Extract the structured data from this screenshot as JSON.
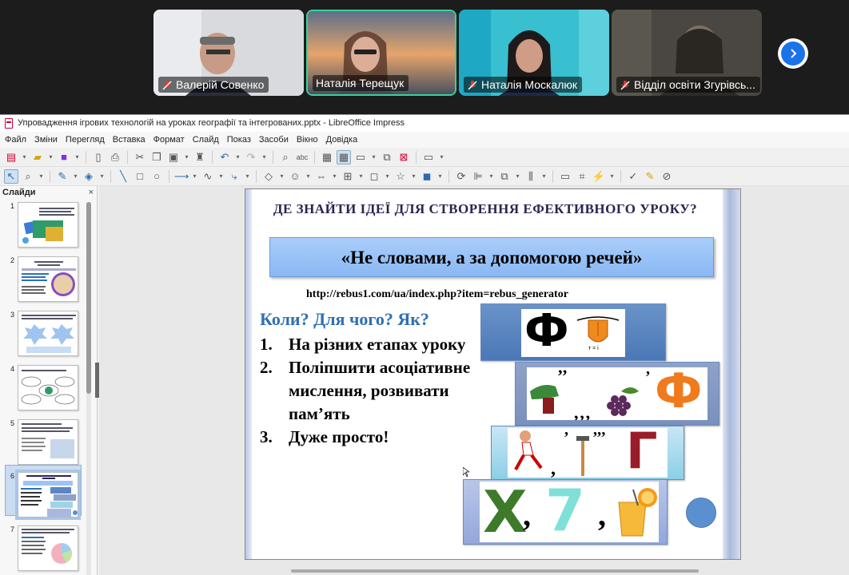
{
  "participants": [
    {
      "name": "Валерій Совенко",
      "muted": true
    },
    {
      "name": "Наталія Терещук",
      "muted": false,
      "active_speaker": true
    },
    {
      "name": "Наталія Москалюк",
      "muted": true
    },
    {
      "name": "Відділ освіти Згурівсь...",
      "muted": true
    }
  ],
  "window": {
    "title": "Упровадження ігрових технологій на уроках географії та інтегрованих.pptx - LibreOffice Impress"
  },
  "menu": [
    "Файл",
    "Зміни",
    "Перегляд",
    "Вставка",
    "Формат",
    "Слайд",
    "Показ",
    "Засоби",
    "Вікно",
    "Довідка"
  ],
  "slides_pane": {
    "title": "Слайди",
    "close": "×",
    "slides": [
      "1",
      "2",
      "3",
      "4",
      "5",
      "6",
      "7"
    ],
    "selected": "6"
  },
  "slide": {
    "title": "ДЕ ЗНАЙТИ ІДЕЇ ДЛЯ СТВОРЕННЯ ЕФЕКТИВНОГО УРОКУ?",
    "quote": "«Не словами, а за допомогою речей»",
    "url": "http://rebus1.com/ua/index.php?item=rebus_generator",
    "subtitle": "Коли? Для чого? Як?",
    "list": [
      {
        "num": "1.",
        "text": "На різних етапах уроку"
      },
      {
        "num": "2.",
        "text": "Поліпшити асоціативне мислення, розвивати пам’ять"
      },
      {
        "num": "3.",
        "text": "Дуже просто!"
      }
    ],
    "rebus": {
      "row1": {
        "letter": "Ф",
        "caption": "т = і"
      },
      "row2": {
        "letter": "Ф",
        "marks": "‚‚"
      },
      "row3": {
        "letter": "Г",
        "marks": "‚‚‚"
      },
      "row4": {
        "letter": "Х",
        "digit": "7"
      }
    }
  },
  "colors": {
    "accent": "#1a73e8",
    "title_text": "#2a2550",
    "subtitle_text": "#2f6fb5",
    "quote_bg": "#9cc3f7"
  }
}
